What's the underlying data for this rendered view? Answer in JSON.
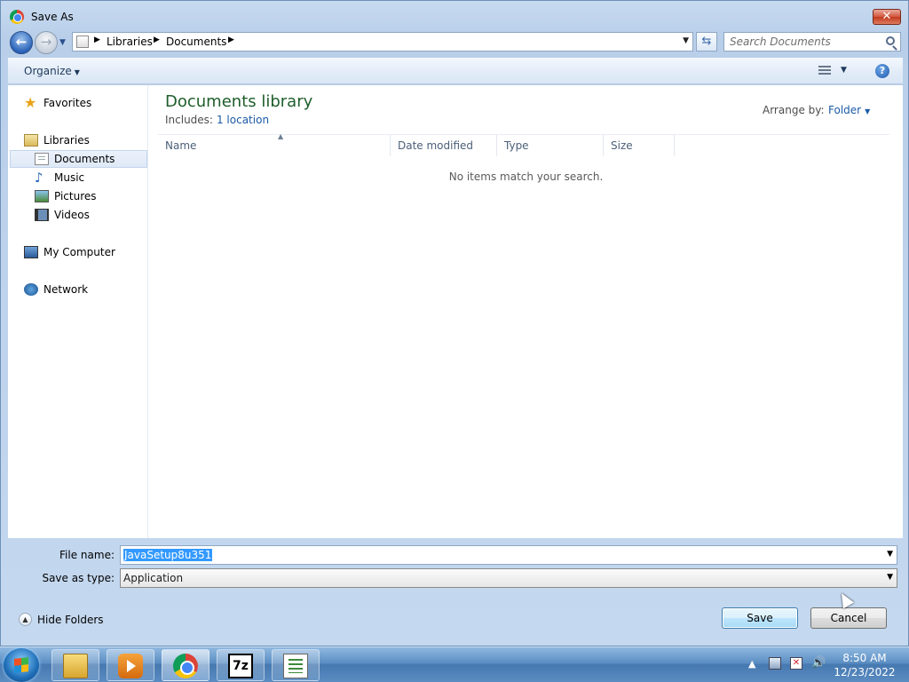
{
  "window": {
    "title": "Save As",
    "close_glyph": "✕"
  },
  "nav": {
    "back_glyph": "←",
    "forward_glyph": "→",
    "breadcrumbs": [
      "Libraries",
      "Documents"
    ],
    "search_placeholder": "Search Documents"
  },
  "toolbar": {
    "organize_label": "Organize",
    "help_glyph": "?"
  },
  "sidebar": {
    "items": [
      {
        "label": "Favorites",
        "icon": "star-icon"
      },
      {
        "label": "Libraries",
        "icon": "library-icon"
      },
      {
        "label": "Documents",
        "icon": "documents-icon",
        "selected": true
      },
      {
        "label": "Music",
        "icon": "music-icon"
      },
      {
        "label": "Pictures",
        "icon": "pictures-icon"
      },
      {
        "label": "Videos",
        "icon": "videos-icon"
      },
      {
        "label": "My Computer",
        "icon": "computer-icon"
      },
      {
        "label": "Network",
        "icon": "network-icon"
      }
    ]
  },
  "content": {
    "library_title": "Documents library",
    "includes_label": "Includes:",
    "includes_link": "1 location",
    "arrange_label": "Arrange by:",
    "arrange_value": "Folder",
    "columns": [
      "Name",
      "Date modified",
      "Type",
      "Size"
    ],
    "empty_message": "No items match your search."
  },
  "form": {
    "filename_label": "File name:",
    "filename_value": "JavaSetup8u351",
    "savetype_label": "Save as type:",
    "savetype_value": "Application",
    "hide_folders_label": "Hide Folders",
    "save_label": "Save",
    "cancel_label": "Cancel"
  },
  "taskbar": {
    "apps": [
      "explorer-icon",
      "media-player-icon",
      "chrome-icon",
      "7zip-icon",
      "task-list-icon"
    ],
    "sevenzip_text": "7z",
    "time": "8:50 AM",
    "date": "12/23/2022"
  },
  "colors": {
    "library_title": "#1e5d2a",
    "link": "#1c5aa6",
    "selection": "#3399ff"
  }
}
